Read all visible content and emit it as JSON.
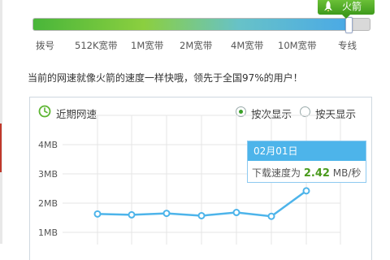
{
  "speed_meter": {
    "badge_label": "火箭",
    "badge_icon": "rocket-icon",
    "level_fraction": 0.94,
    "ticks": [
      "拨号",
      "512K宽带",
      "1M宽带",
      "2M宽带",
      "4M宽带",
      "10M宽带",
      "专线"
    ]
  },
  "status_message": "当前的网速就像火箭的速度一样快哦，领先于全国97%的用户！",
  "panel": {
    "title": "近期网速",
    "title_icon": "clock-icon",
    "radio_by_count": "按次显示",
    "radio_by_day": "按天显示",
    "selected": "按次显示"
  },
  "tooltip": {
    "date": "02月01日",
    "label": "下载速度为",
    "value": "2.42",
    "unit": "MB/秒"
  },
  "colors": {
    "accent_green": "#3e9a1c",
    "line_blue": "#4db4ea",
    "grid": "#e6e6e6"
  },
  "chart_data": {
    "type": "line",
    "y_tick_labels": [
      "4MB",
      "3MB",
      "2MB",
      "1MB"
    ],
    "ylim": [
      1,
      4
    ],
    "grid": true,
    "series": [
      {
        "values": [
          1.63,
          1.6,
          1.65,
          1.57,
          1.68,
          1.55,
          2.42
        ]
      }
    ]
  }
}
